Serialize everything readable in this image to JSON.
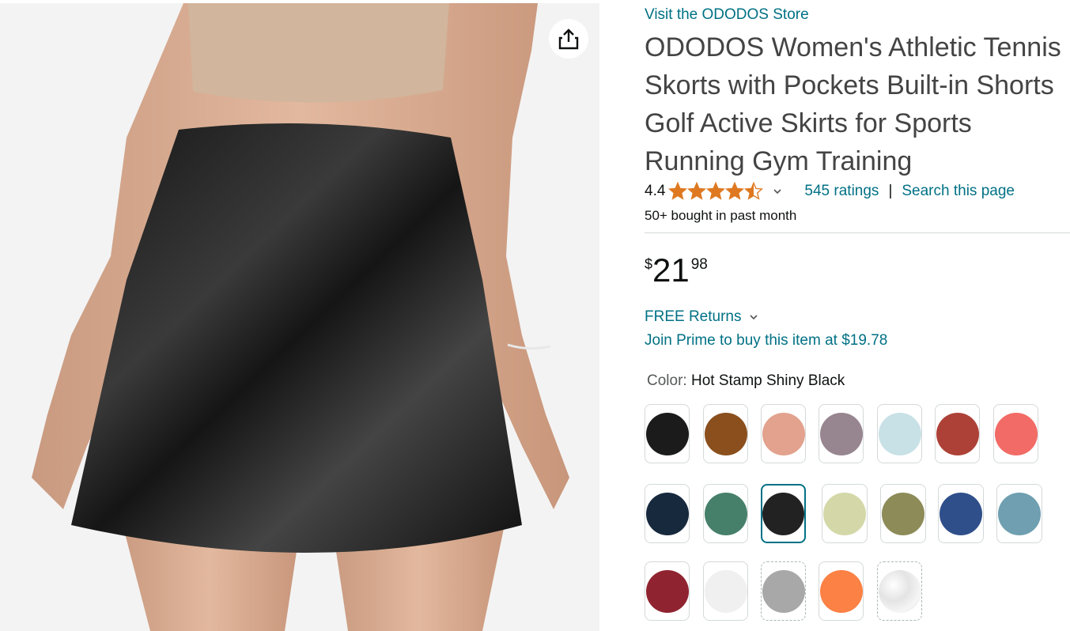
{
  "header": {
    "store_link": "Visit the ODODOS Store",
    "title": "ODODOS Women's Athletic Tennis Skorts with Pockets Built-in Shorts Golf Active Skirts for Sports Running Gym Training"
  },
  "rating": {
    "value": "4.4",
    "stars": 4.4,
    "ratings_count": "545 ratings",
    "separator": "|",
    "search_link": "Search this page"
  },
  "social_proof": "50+ bought in past month",
  "price": {
    "symbol": "$",
    "whole": "21",
    "fraction": "98"
  },
  "returns": {
    "label": "FREE Returns"
  },
  "prime": {
    "label": "Join Prime to buy this item at $19.78"
  },
  "color": {
    "label": "Color:",
    "selected": "Hot Stamp Shiny Black"
  },
  "swatches": [
    {
      "color": "#1b1b1b"
    },
    {
      "color": "#8a4f1d"
    },
    {
      "color": "#e2a28e"
    },
    {
      "color": "#978590"
    },
    {
      "color": "#c8e1e6"
    },
    {
      "color": "#ad4137"
    },
    {
      "color": "#f26b66"
    },
    {
      "color": "#17293d"
    },
    {
      "color": "#46806a"
    },
    {
      "color": "#222222",
      "selected": true
    },
    {
      "color": "#d4d8a8"
    },
    {
      "color": "#8d8b58"
    },
    {
      "color": "#2f4f8a"
    },
    {
      "color": "#6f9fb0"
    },
    {
      "color": "#8f2430"
    },
    {
      "color": "#f0f0f0"
    },
    {
      "color": "#a8a8a8"
    },
    {
      "color": "#fb8145"
    },
    {
      "color": "#eeeeee"
    }
  ],
  "colors": {
    "link": "#007185",
    "star": "#de7921",
    "text": "#0f1111"
  }
}
